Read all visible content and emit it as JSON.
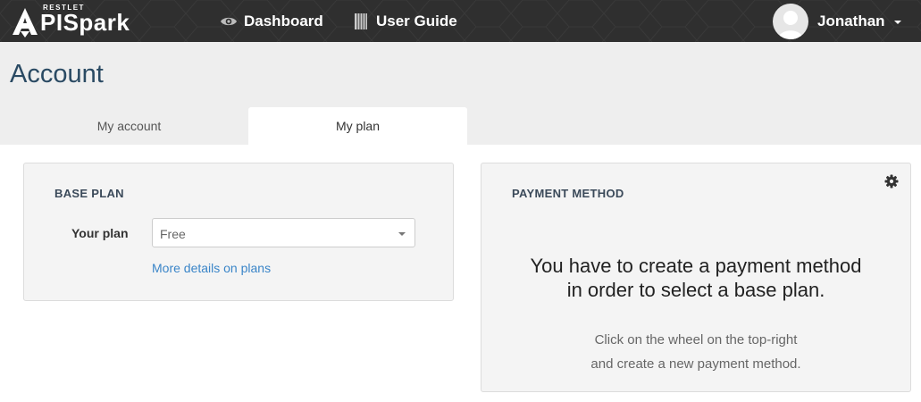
{
  "brand": {
    "tagline": "RESTLET",
    "name": "PISpark"
  },
  "nav": {
    "dashboard": "Dashboard",
    "user_guide": "User Guide"
  },
  "user": {
    "name": "Jonathan"
  },
  "page": {
    "title": "Account"
  },
  "tabs": [
    {
      "label": "My account",
      "active": false
    },
    {
      "label": "My plan",
      "active": true
    }
  ],
  "base_plan": {
    "title": "BASE PLAN",
    "field_label": "Your plan",
    "selected": "Free",
    "details_link": "More details on plans"
  },
  "payment": {
    "title": "PAYMENT METHOD",
    "message_line1": "You have to create a payment method",
    "message_line2": "in order to select a base plan.",
    "hint_line1": "Click on the wheel on the top-right",
    "hint_line2": "and create a new payment method."
  },
  "colors": {
    "topbar": "#2f2f2f",
    "link": "#3a85c8",
    "title": "#2a4a63"
  }
}
